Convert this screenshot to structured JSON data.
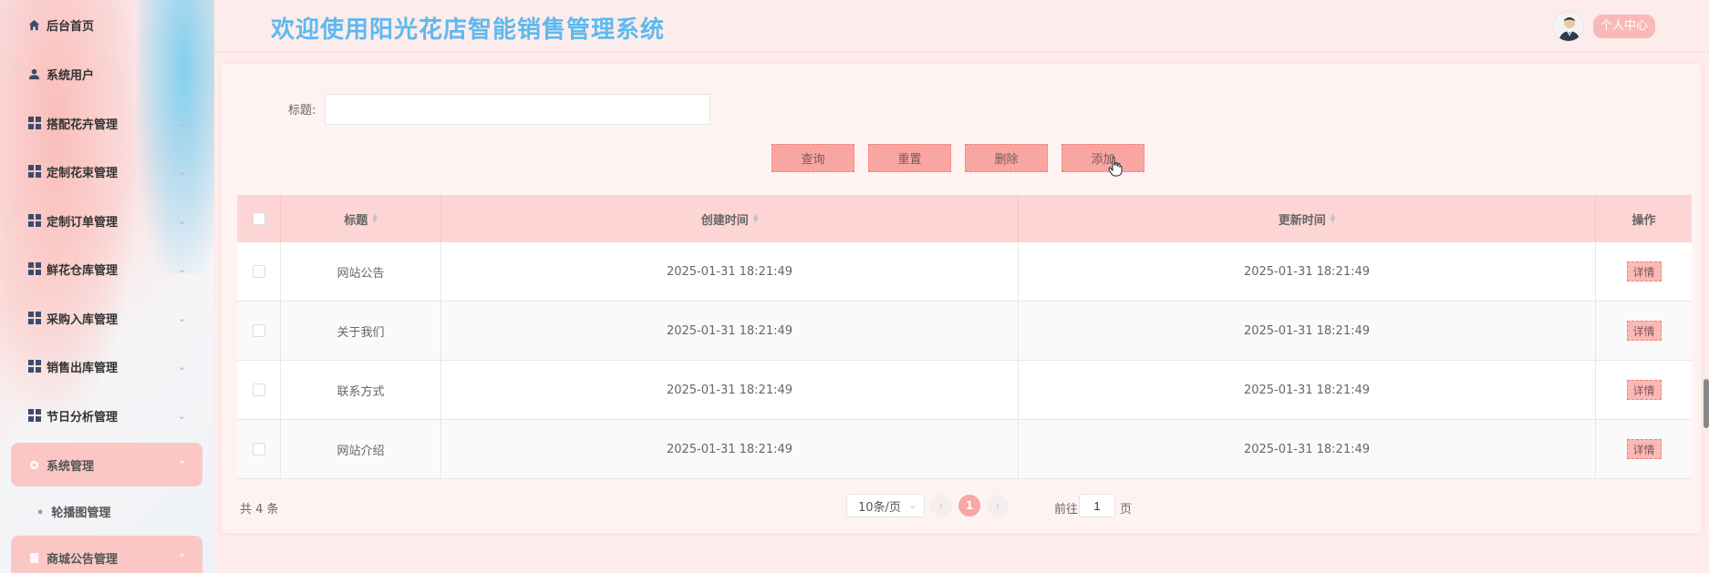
{
  "header": {
    "title": "欢迎使用阳光花店智能销售管理系统",
    "personal_center": "个人中心"
  },
  "sidebar": {
    "items": [
      {
        "label": "后台首页",
        "icon": "home-icon"
      },
      {
        "label": "系统用户",
        "icon": "user-icon"
      },
      {
        "label": "搭配花卉管理",
        "icon": "grid-icon"
      },
      {
        "label": "定制花束管理",
        "icon": "grid-icon"
      },
      {
        "label": "定制订单管理",
        "icon": "grid-icon"
      },
      {
        "label": "鲜花仓库管理",
        "icon": "grid-icon"
      },
      {
        "label": "采购入库管理",
        "icon": "grid-icon"
      },
      {
        "label": "销售出库管理",
        "icon": "grid-icon"
      },
      {
        "label": "节日分析管理",
        "icon": "grid-icon"
      },
      {
        "label": "系统管理",
        "icon": "gear-icon"
      },
      {
        "label": "商城公告管理",
        "icon": "document-icon"
      }
    ],
    "submenu": {
      "label": "轮播图管理"
    }
  },
  "search": {
    "label": "标题:",
    "value": "",
    "placeholder": ""
  },
  "buttons": {
    "query": "查询",
    "reset": "重置",
    "delete": "删除",
    "add": "添加"
  },
  "table": {
    "headers": {
      "title": "标题",
      "created": "创建时间",
      "updated": "更新时间",
      "op": "操作"
    },
    "rows": [
      {
        "title": "网站公告",
        "created": "2025-01-31 18:21:49",
        "updated": "2025-01-31 18:21:49",
        "action": "详情"
      },
      {
        "title": "关于我们",
        "created": "2025-01-31 18:21:49",
        "updated": "2025-01-31 18:21:49",
        "action": "详情"
      },
      {
        "title": "联系方式",
        "created": "2025-01-31 18:21:49",
        "updated": "2025-01-31 18:21:49",
        "action": "详情"
      },
      {
        "title": "网站介绍",
        "created": "2025-01-31 18:21:49",
        "updated": "2025-01-31 18:21:49",
        "action": "详情"
      }
    ]
  },
  "pagination": {
    "total": "共 4 条",
    "page_size": "10条/页",
    "current_page": "1",
    "goto_label": "前往",
    "goto_value": "1",
    "goto_suffix": "页"
  },
  "colors": {
    "accent": "#f9a6a3",
    "title": "#5db9ee",
    "header_row": "#fdd5d4"
  }
}
